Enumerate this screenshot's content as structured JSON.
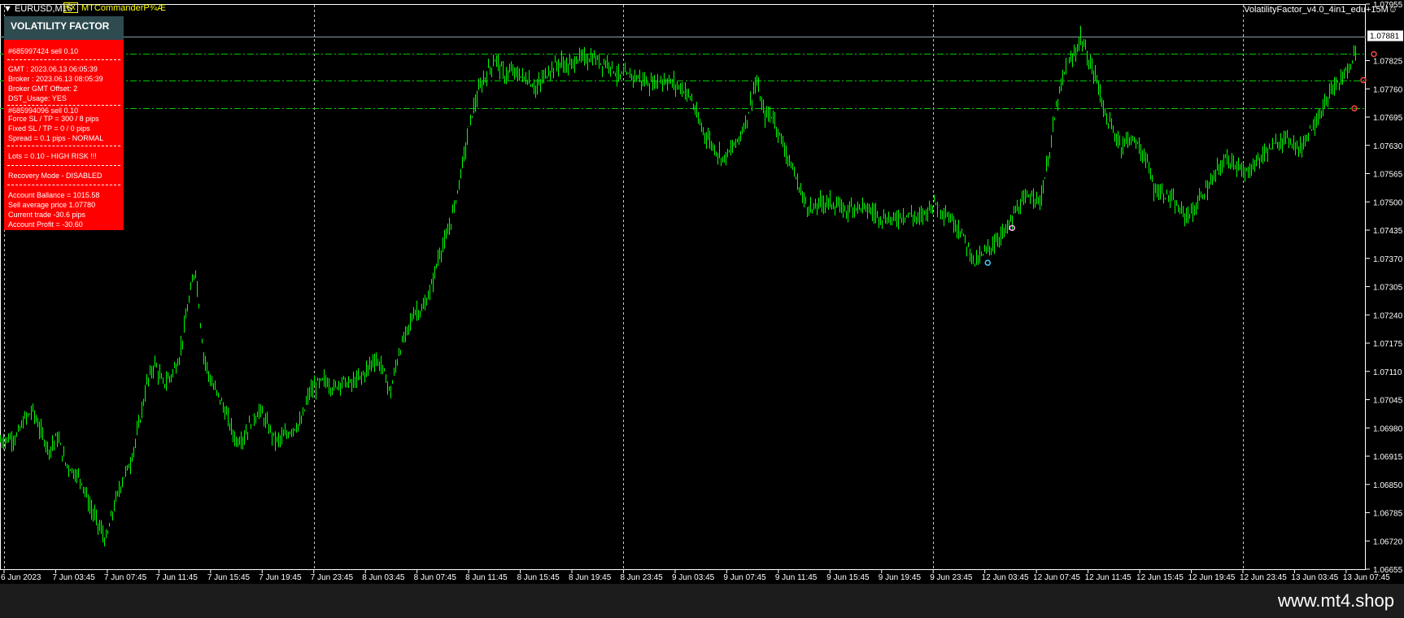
{
  "window": {
    "symbol": "EURUSD,M15",
    "ea_badge": "€x",
    "ea_name": "MTCommanderP¾Æ",
    "indicator_label": "VolatilityFactor_v4.0_4in1_edu+15M☺"
  },
  "panel": {
    "title": "VOLATILITY FACTOR",
    "lines": [
      "#685997424 sell 0.10",
      "GMT : 2023.06.13 06:05:39",
      "Broker : 2023.06.13 08:05:39",
      "Broker GMT Offset: 2",
      "DST_Usage: YES",
      "#685994096 sell 0.10",
      "Force SL / TP = 300 / 8 pips",
      "Fixed SL / TP = 0 / 0 pips",
      "Spread = 0.1 pips - NORMAL",
      "Lots = 0.10 - HIGH RISK !!!",
      "Recovery Mode - DISABLED",
      "Account Ballance = 1015.58",
      "Sell average price 1.07780",
      "Current trade -30.6 pips",
      "Account Profit = -30.60"
    ]
  },
  "watermark": "www.mt4.shop",
  "colors": {
    "candle": "#00ff00",
    "panel": "#ff0000",
    "panel_header": "#2e4b50",
    "background": "#000000"
  },
  "chart_data": {
    "type": "candlestick-line",
    "current_price": "1.07881",
    "price_labels": [
      "1.07955",
      "1.07825",
      "1.07760",
      "1.07695",
      "1.07630",
      "1.07565",
      "1.07500",
      "1.07435",
      "1.07370",
      "1.07305",
      "1.07240",
      "1.07175",
      "1.07110",
      "1.07045",
      "1.06980",
      "1.06915",
      "1.06850",
      "1.06785",
      "1.06720",
      "1.06655"
    ],
    "time_labels": [
      "6 Jun 2023",
      "7 Jun 03:45",
      "7 Jun 07:45",
      "7 Jun 11:45",
      "7 Jun 15:45",
      "7 Jun 19:45",
      "7 Jun 23:45",
      "8 Jun 03:45",
      "8 Jun 07:45",
      "8 Jun 11:45",
      "8 Jun 15:45",
      "8 Jun 19:45",
      "8 Jun 23:45",
      "9 Jun 03:45",
      "9 Jun 07:45",
      "9 Jun 11:45",
      "9 Jun 15:45",
      "9 Jun 19:45",
      "9 Jun 23:45",
      "12 Jun 03:45",
      "12 Jun 07:45",
      "12 Jun 11:45",
      "12 Jun 15:45",
      "12 Jun 19:45",
      "12 Jun 23:45",
      "13 Jun 03:45",
      "13 Jun 07:45"
    ],
    "ylim": [
      1.06655,
      1.07955
    ],
    "order_levels": [
      1.07881,
      1.0784,
      1.0778,
      1.07715
    ],
    "day_separators": [
      "7 Jun 23:45",
      "8 Jun 23:45",
      "9 Jun 23:45",
      "12 Jun 23:45"
    ],
    "price_path": [
      [
        0,
        1.0695
      ],
      [
        2,
        1.06955
      ],
      [
        4,
        1.0696
      ],
      [
        5,
        1.07
      ],
      [
        6,
        1.0702
      ],
      [
        7,
        1.0697
      ],
      [
        8,
        1.0693
      ],
      [
        9,
        1.0696
      ],
      [
        10,
        1.069
      ],
      [
        11,
        1.0688
      ],
      [
        12,
        1.0686
      ],
      [
        13,
        1.068
      ],
      [
        14,
        1.0676
      ],
      [
        15,
        1.0672
      ],
      [
        16,
        1.068
      ],
      [
        17,
        1.0686
      ],
      [
        18,
        1.069
      ],
      [
        19,
        1.0698
      ],
      [
        20,
        1.0708
      ],
      [
        21,
        1.0713
      ],
      [
        22,
        1.0708
      ],
      [
        23,
        1.071
      ],
      [
        24,
        1.0714
      ],
      [
        25,
        1.0725
      ],
      [
        26,
        1.0735
      ],
      [
        27,
        1.0715
      ],
      [
        28,
        1.0708
      ],
      [
        29,
        1.0705
      ],
      [
        30,
        1.07
      ],
      [
        31,
        1.0695
      ],
      [
        32,
        1.0696
      ],
      [
        33,
        1.07
      ],
      [
        34,
        1.0702
      ],
      [
        35,
        1.0698
      ],
      [
        36,
        1.0695
      ],
      [
        37,
        1.0696
      ],
      [
        38,
        1.0698
      ],
      [
        39,
        1.0699
      ],
      [
        40,
        1.0706
      ],
      [
        41,
        1.0708
      ],
      [
        42,
        1.0709
      ],
      [
        43,
        1.0707
      ],
      [
        44,
        1.0709
      ],
      [
        45,
        1.0708
      ],
      [
        46,
        1.0709
      ],
      [
        47,
        1.0711
      ],
      [
        48,
        1.0714
      ],
      [
        49,
        1.0712
      ],
      [
        50,
        1.0706
      ],
      [
        51,
        1.0715
      ],
      [
        52,
        1.072
      ],
      [
        53,
        1.0725
      ],
      [
        54,
        1.0725
      ],
      [
        55,
        1.073
      ],
      [
        56,
        1.0738
      ],
      [
        57,
        1.0742
      ],
      [
        58,
        1.075
      ],
      [
        59,
        1.076
      ],
      [
        60,
        1.077
      ],
      [
        61,
        1.0776
      ],
      [
        62,
        1.078
      ],
      [
        63,
        1.0783
      ],
      [
        64,
        1.0779
      ],
      [
        65,
        1.078
      ],
      [
        66,
        1.0779
      ],
      [
        67,
        1.0778
      ],
      [
        68,
        1.0776
      ],
      [
        69,
        1.0779
      ],
      [
        70,
        1.0781
      ],
      [
        71,
        1.0782
      ],
      [
        72,
        1.0781
      ],
      [
        73,
        1.0783
      ],
      [
        74,
        1.0783
      ],
      [
        75,
        1.0783
      ],
      [
        76,
        1.0782
      ],
      [
        77,
        1.0782
      ],
      [
        78,
        1.0779
      ],
      [
        79,
        1.0779
      ],
      [
        80,
        1.0779
      ],
      [
        81,
        1.0778
      ],
      [
        82,
        1.0777
      ],
      [
        83,
        1.0778
      ],
      [
        84,
        1.0778
      ],
      [
        85,
        1.0777
      ],
      [
        86,
        1.0776
      ],
      [
        87,
        1.0774
      ],
      [
        88,
        1.0768
      ],
      [
        89,
        1.0765
      ],
      [
        90,
        1.0762
      ],
      [
        91,
        1.076
      ],
      [
        92,
        1.0762
      ],
      [
        93,
        1.0765
      ],
      [
        94,
        1.077
      ],
      [
        95,
        1.0778
      ],
      [
        96,
        1.077
      ],
      [
        97,
        1.077
      ],
      [
        98,
        1.0765
      ],
      [
        99,
        1.076
      ],
      [
        100,
        1.0755
      ],
      [
        101,
        1.075
      ],
      [
        102,
        1.0748
      ],
      [
        103,
        1.075
      ],
      [
        104,
        1.075
      ],
      [
        105,
        1.0749
      ],
      [
        106,
        1.0748
      ],
      [
        107,
        1.0749
      ],
      [
        108,
        1.0749
      ],
      [
        109,
        1.0748
      ],
      [
        110,
        1.0747
      ],
      [
        111,
        1.0746
      ],
      [
        112,
        1.0746
      ],
      [
        113,
        1.0747
      ],
      [
        114,
        1.0747
      ],
      [
        115,
        1.0746
      ],
      [
        116,
        1.0748
      ],
      [
        117,
        1.075
      ],
      [
        118,
        1.0748
      ],
      [
        119,
        1.0746
      ],
      [
        120,
        1.0744
      ],
      [
        121,
        1.074
      ],
      [
        122,
        1.0736
      ],
      [
        123,
        1.0738
      ],
      [
        124,
        1.074
      ],
      [
        125,
        1.0742
      ],
      [
        126,
        1.0744
      ],
      [
        127,
        1.0748
      ],
      [
        128,
        1.075
      ],
      [
        129,
        1.0752
      ],
      [
        130,
        1.075
      ],
      [
        131,
        1.076
      ],
      [
        132,
        1.0772
      ],
      [
        133,
        1.078
      ],
      [
        134,
        1.0783
      ],
      [
        135,
        1.0788
      ],
      [
        136,
        1.0782
      ],
      [
        137,
        1.0778
      ],
      [
        138,
        1.077
      ],
      [
        139,
        1.0766
      ],
      [
        140,
        1.0763
      ],
      [
        141,
        1.0765
      ],
      [
        142,
        1.0763
      ],
      [
        143,
        1.076
      ],
      [
        144,
        1.0753
      ],
      [
        145,
        1.0752
      ],
      [
        146,
        1.0751
      ],
      [
        147,
        1.0748
      ],
      [
        148,
        1.0747
      ],
      [
        149,
        1.0748
      ],
      [
        150,
        1.0752
      ],
      [
        151,
        1.0754
      ],
      [
        152,
        1.0758
      ],
      [
        153,
        1.076
      ],
      [
        154,
        1.0759
      ],
      [
        155,
        1.0756
      ],
      [
        156,
        1.0758
      ],
      [
        157,
        1.076
      ],
      [
        158,
        1.0762
      ],
      [
        159,
        1.0763
      ],
      [
        160,
        1.0765
      ],
      [
        161,
        1.0764
      ],
      [
        162,
        1.0762
      ],
      [
        163,
        1.0766
      ],
      [
        164,
        1.0769
      ],
      [
        165,
        1.0772
      ],
      [
        166,
        1.0776
      ],
      [
        167,
        1.0778
      ],
      [
        168,
        1.0781
      ],
      [
        169,
        1.0786
      ]
    ]
  }
}
